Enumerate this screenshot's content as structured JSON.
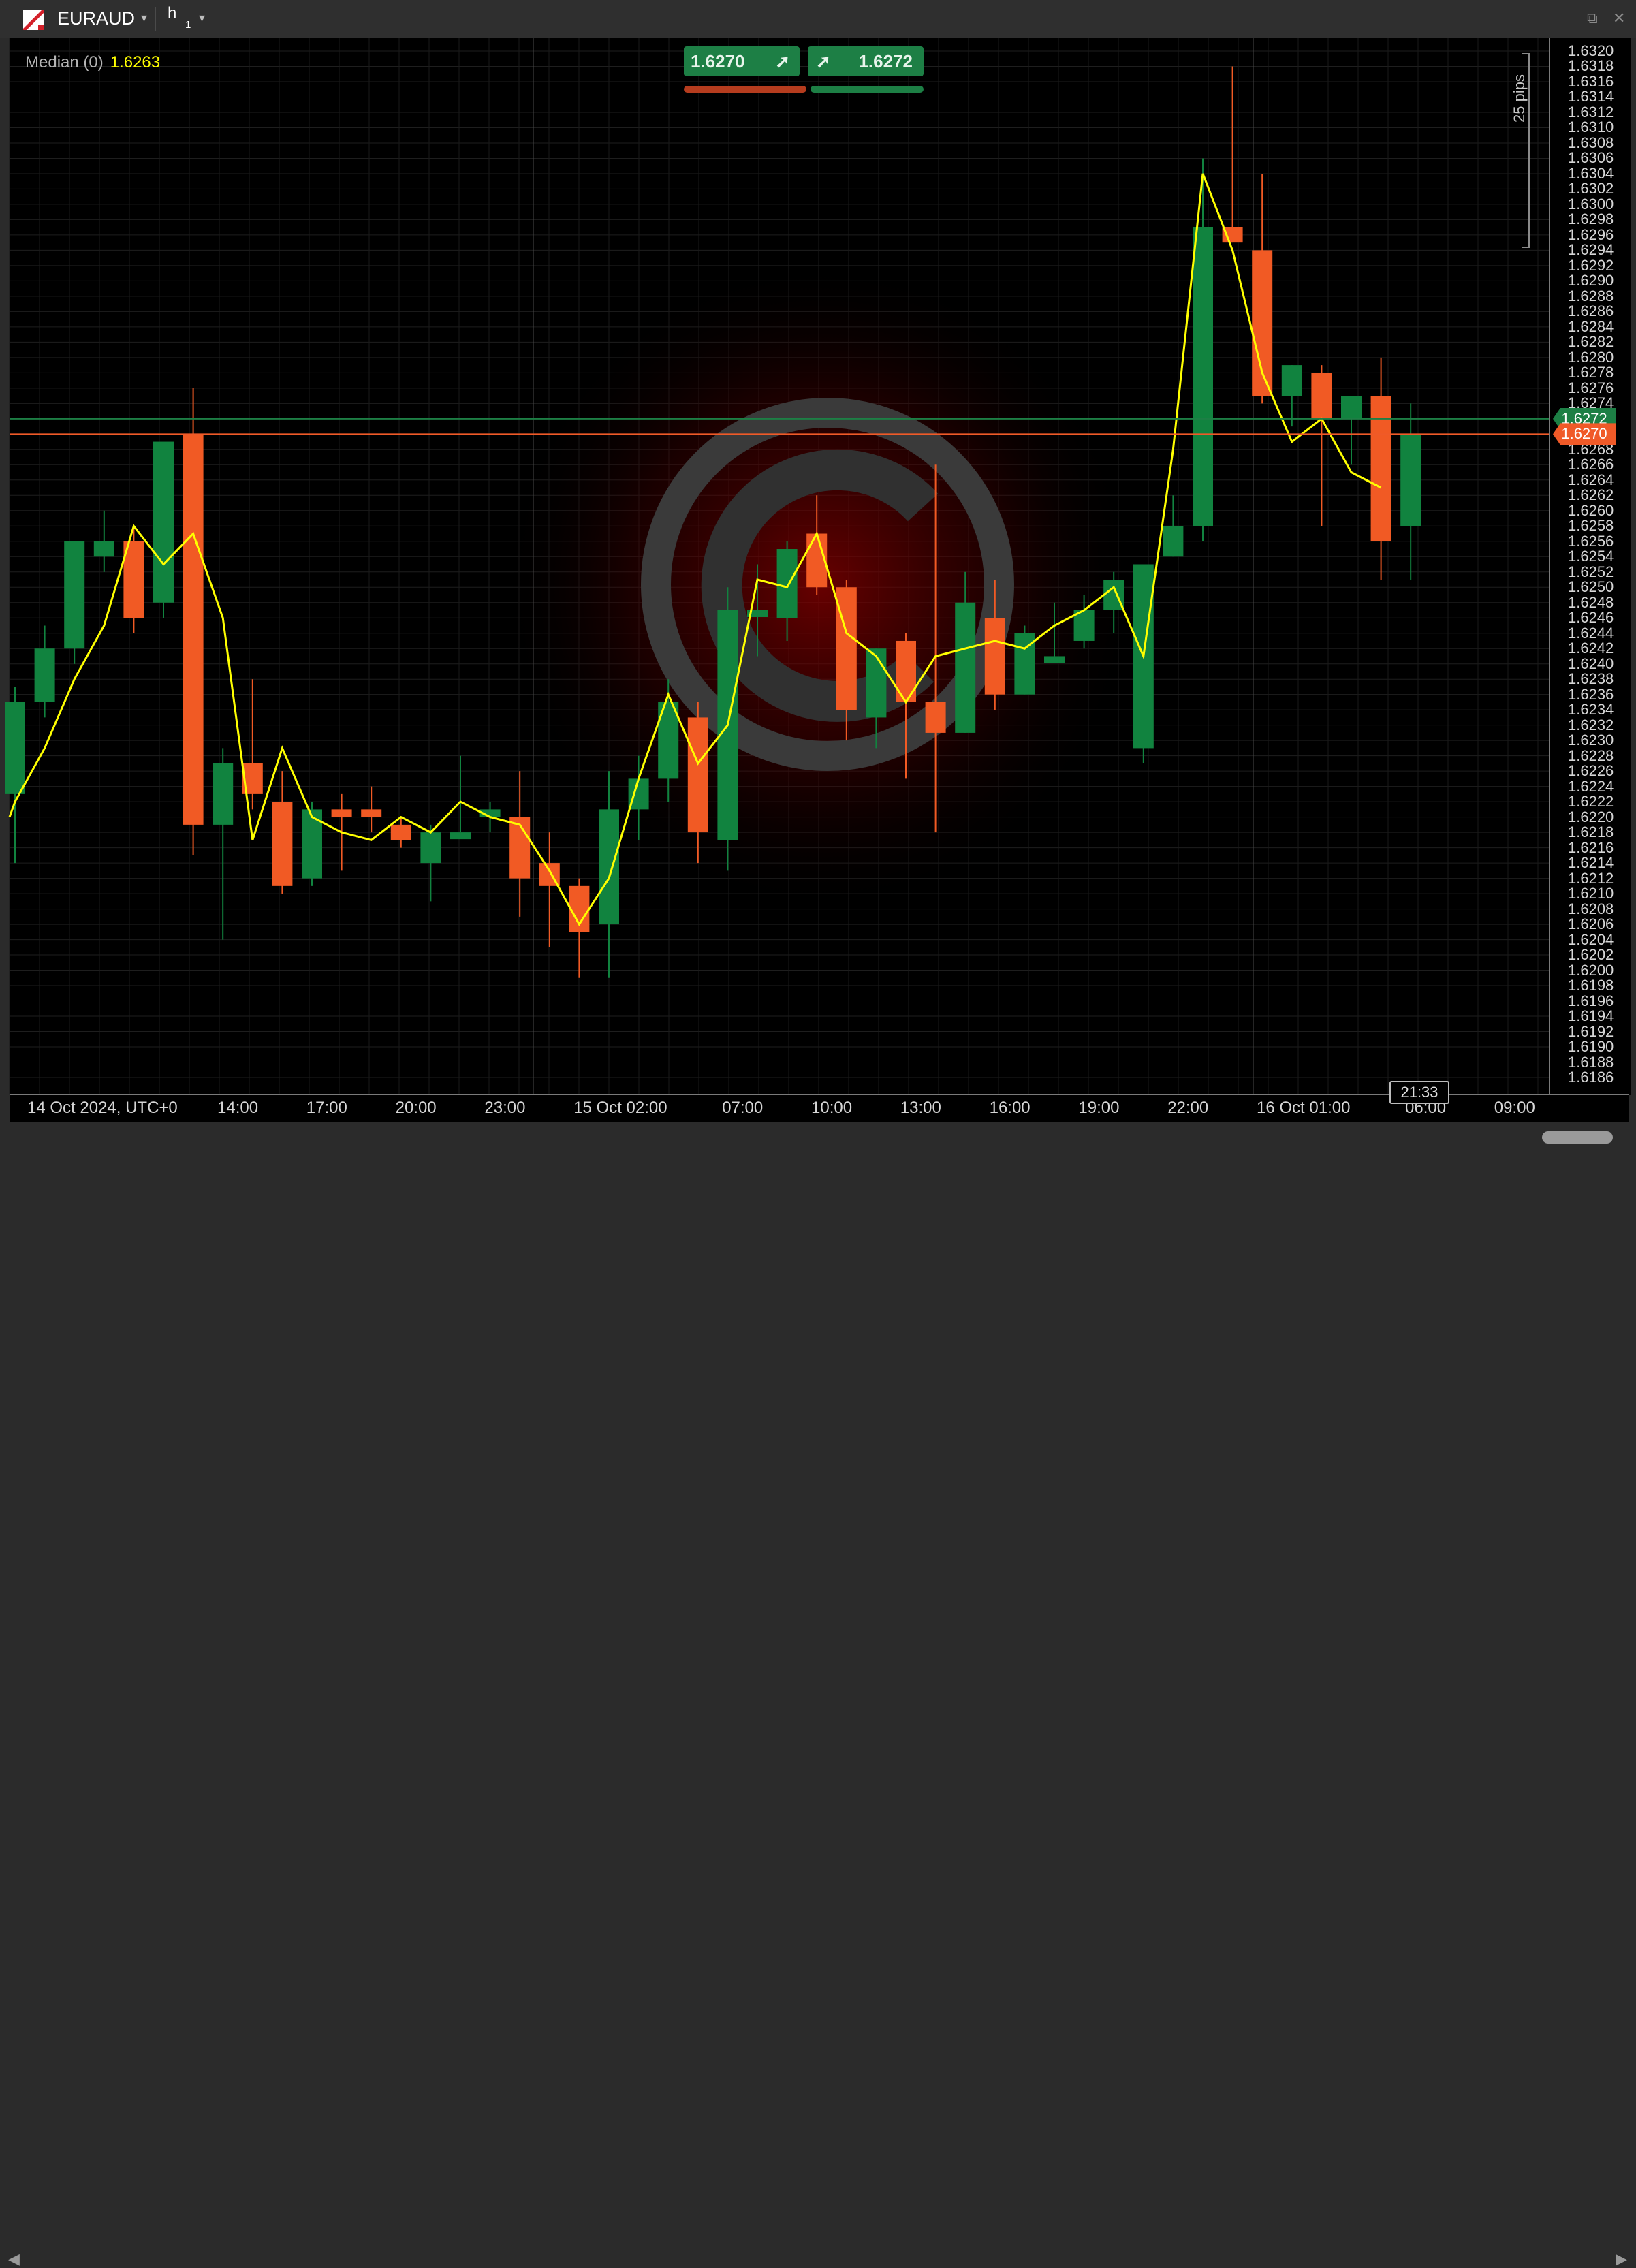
{
  "header": {
    "symbol": "EURAUD",
    "timeframe": "h",
    "timeframe_sub": "1"
  },
  "indicator": {
    "label": "Median (0)",
    "value": "1.6263"
  },
  "quote": {
    "sell": "1.6270",
    "buy": "1.6272",
    "sell_color": "#1d7f45",
    "buy_color": "#1d7f45"
  },
  "ruler": {
    "label": "25 pips"
  },
  "current_prices": {
    "ask": "1.6272",
    "bid": "1.6270",
    "ask_color": "#1d7f45",
    "bid_color": "#f05a28"
  },
  "countdown": "21:33",
  "chart_data": {
    "type": "candlestick",
    "symbol": "EURAUD",
    "timeframe": "h1",
    "ylim": [
      1.6184,
      1.6322
    ],
    "price_ticks": [
      "1.6320",
      "1.6318",
      "1.6316",
      "1.6314",
      "1.6312",
      "1.6310",
      "1.6308",
      "1.6306",
      "1.6304",
      "1.6302",
      "1.6300",
      "1.6298",
      "1.6296",
      "1.6294",
      "1.6292",
      "1.6290",
      "1.6288",
      "1.6286",
      "1.6284",
      "1.6282",
      "1.6280",
      "1.6278",
      "1.6276",
      "1.6274",
      "1.6272",
      "1.6270",
      "1.6268",
      "1.6266",
      "1.6264",
      "1.6262",
      "1.6260",
      "1.6258",
      "1.6256",
      "1.6254",
      "1.6252",
      "1.6250",
      "1.6248",
      "1.6246",
      "1.6244",
      "1.6242",
      "1.6240",
      "1.6238",
      "1.6236",
      "1.6234",
      "1.6232",
      "1.6230",
      "1.6228",
      "1.6226",
      "1.6224",
      "1.6222",
      "1.6220",
      "1.6218",
      "1.6216",
      "1.6214",
      "1.6212",
      "1.6210",
      "1.6208",
      "1.6206",
      "1.6204",
      "1.6202",
      "1.6200",
      "1.6198",
      "1.6196",
      "1.6194",
      "1.6192",
      "1.6190",
      "1.6188",
      "1.6186"
    ],
    "time_labels": [
      {
        "text": "14 Oct 2024, UTC+0",
        "index": 0.3
      },
      {
        "text": "14:00",
        "index": 7.5
      },
      {
        "text": "17:00",
        "index": 10.5
      },
      {
        "text": "20:00",
        "index": 13.5
      },
      {
        "text": "23:00",
        "index": 16.5
      },
      {
        "text": "15 Oct 02:00",
        "index": 19.5
      },
      {
        "text": "07:00",
        "index": 24.5
      },
      {
        "text": "10:00",
        "index": 27.5
      },
      {
        "text": "13:00",
        "index": 30.5
      },
      {
        "text": "16:00",
        "index": 33.5
      },
      {
        "text": "19:00",
        "index": 36.5
      },
      {
        "text": "22:00",
        "index": 39.5
      },
      {
        "text": "16 Oct 01:00",
        "index": 42.5
      },
      {
        "text": "06:00",
        "index": 47.5
      },
      {
        "text": "09:00",
        "index": 50.5
      }
    ],
    "candles": [
      {
        "o": 1.6223,
        "h": 1.6237,
        "l": 1.6214,
        "c": 1.6235
      },
      {
        "o": 1.6235,
        "h": 1.6245,
        "l": 1.6233,
        "c": 1.6242
      },
      {
        "o": 1.6242,
        "h": 1.6256,
        "l": 1.624,
        "c": 1.6256
      },
      {
        "o": 1.6254,
        "h": 1.626,
        "l": 1.6252,
        "c": 1.6256
      },
      {
        "o": 1.6256,
        "h": 1.6258,
        "l": 1.6244,
        "c": 1.6246
      },
      {
        "o": 1.6248,
        "h": 1.6268,
        "l": 1.6246,
        "c": 1.6269
      },
      {
        "o": 1.627,
        "h": 1.6276,
        "l": 1.6215,
        "c": 1.6219
      },
      {
        "o": 1.6219,
        "h": 1.6229,
        "l": 1.6204,
        "c": 1.6227
      },
      {
        "o": 1.6227,
        "h": 1.6238,
        "l": 1.6221,
        "c": 1.6223
      },
      {
        "o": 1.6222,
        "h": 1.6226,
        "l": 1.621,
        "c": 1.6211
      },
      {
        "o": 1.6212,
        "h": 1.6222,
        "l": 1.6211,
        "c": 1.6221
      },
      {
        "o": 1.6221,
        "h": 1.6223,
        "l": 1.6213,
        "c": 1.622
      },
      {
        "o": 1.6221,
        "h": 1.6224,
        "l": 1.6218,
        "c": 1.622
      },
      {
        "o": 1.6219,
        "h": 1.622,
        "l": 1.6216,
        "c": 1.6217
      },
      {
        "o": 1.6214,
        "h": 1.6219,
        "l": 1.6209,
        "c": 1.6218
      },
      {
        "o": 1.6218,
        "h": 1.6228,
        "l": 1.6218,
        "c": 1.6218
      },
      {
        "o": 1.622,
        "h": 1.6222,
        "l": 1.6218,
        "c": 1.6221
      },
      {
        "o": 1.622,
        "h": 1.6226,
        "l": 1.6207,
        "c": 1.6212
      },
      {
        "o": 1.6214,
        "h": 1.6218,
        "l": 1.6203,
        "c": 1.6211
      },
      {
        "o": 1.6211,
        "h": 1.6212,
        "l": 1.6199,
        "c": 1.6205
      },
      {
        "o": 1.6206,
        "h": 1.6226,
        "l": 1.6199,
        "c": 1.6221
      },
      {
        "o": 1.6221,
        "h": 1.6228,
        "l": 1.6217,
        "c": 1.6225
      },
      {
        "o": 1.6225,
        "h": 1.6238,
        "l": 1.6222,
        "c": 1.6235
      },
      {
        "o": 1.6233,
        "h": 1.6235,
        "l": 1.6214,
        "c": 1.6218
      },
      {
        "o": 1.6217,
        "h": 1.625,
        "l": 1.6213,
        "c": 1.6247
      },
      {
        "o": 1.6247,
        "h": 1.6253,
        "l": 1.6241,
        "c": 1.6247
      },
      {
        "o": 1.6246,
        "h": 1.6256,
        "l": 1.6243,
        "c": 1.6255
      },
      {
        "o": 1.6257,
        "h": 1.6262,
        "l": 1.6249,
        "c": 1.625
      },
      {
        "o": 1.625,
        "h": 1.6251,
        "l": 1.623,
        "c": 1.6234
      },
      {
        "o": 1.6233,
        "h": 1.6242,
        "l": 1.6229,
        "c": 1.6242
      },
      {
        "o": 1.6243,
        "h": 1.6244,
        "l": 1.6225,
        "c": 1.6235
      },
      {
        "o": 1.6235,
        "h": 1.6266,
        "l": 1.6218,
        "c": 1.6231
      },
      {
        "o": 1.6231,
        "h": 1.6252,
        "l": 1.6231,
        "c": 1.6248
      },
      {
        "o": 1.6246,
        "h": 1.6251,
        "l": 1.6234,
        "c": 1.6236
      },
      {
        "o": 1.6236,
        "h": 1.6245,
        "l": 1.6236,
        "c": 1.6244
      },
      {
        "o": 1.6241,
        "h": 1.6248,
        "l": 1.6241,
        "c": 1.6241
      },
      {
        "o": 1.6243,
        "h": 1.6249,
        "l": 1.6242,
        "c": 1.6247
      },
      {
        "o": 1.6247,
        "h": 1.6252,
        "l": 1.6244,
        "c": 1.6251
      },
      {
        "o": 1.6229,
        "h": 1.6253,
        "l": 1.6227,
        "c": 1.6253
      },
      {
        "o": 1.6254,
        "h": 1.6262,
        "l": 1.6254,
        "c": 1.6258
      },
      {
        "o": 1.6258,
        "h": 1.6306,
        "l": 1.6256,
        "c": 1.6297
      },
      {
        "o": 1.6297,
        "h": 1.6318,
        "l": 1.6295,
        "c": 1.6295
      },
      {
        "o": 1.6294,
        "h": 1.6304,
        "l": 1.6274,
        "c": 1.6275
      },
      {
        "o": 1.6275,
        "h": 1.6279,
        "l": 1.6271,
        "c": 1.6279
      },
      {
        "o": 1.6278,
        "h": 1.6279,
        "l": 1.6258,
        "c": 1.6272
      },
      {
        "o": 1.6272,
        "h": 1.6275,
        "l": 1.6266,
        "c": 1.6275
      },
      {
        "o": 1.6275,
        "h": 1.628,
        "l": 1.6251,
        "c": 1.6256
      },
      {
        "o": 1.6258,
        "h": 1.6274,
        "l": 1.6251,
        "c": 1.627
      }
    ],
    "series": [
      {
        "name": "Median (0)",
        "values": [
          1.6222,
          1.6229,
          1.6238,
          1.6245,
          1.6258,
          1.6253,
          1.6257,
          1.6246,
          1.6217,
          1.6229,
          1.622,
          1.6218,
          1.6217,
          1.622,
          1.6218,
          1.6222,
          1.622,
          1.6219,
          1.6213,
          1.6206,
          1.6212,
          1.6225,
          1.6236,
          1.6227,
          1.6232,
          1.6251,
          1.625,
          1.6257,
          1.6244,
          1.6241,
          1.6235,
          1.6241,
          1.6242,
          1.6243,
          1.6242,
          1.6245,
          1.6247,
          1.625,
          1.6241,
          1.6268,
          1.6304,
          1.6294,
          1.6278,
          1.6269,
          1.6272,
          1.6265,
          1.6263
        ]
      }
    ],
    "ask": 1.6272,
    "bid": 1.627,
    "up_color": "#11833f",
    "down_color": "#f15a24",
    "median_color": "#ffff00",
    "grid": true
  }
}
